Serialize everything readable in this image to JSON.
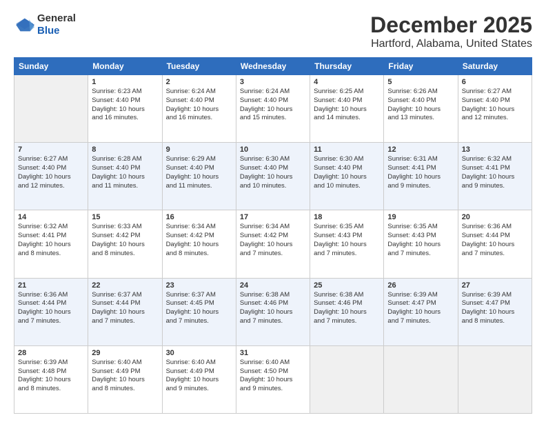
{
  "header": {
    "logo_general": "General",
    "logo_blue": "Blue",
    "title": "December 2025",
    "subtitle": "Hartford, Alabama, United States"
  },
  "calendar": {
    "days_of_week": [
      "Sunday",
      "Monday",
      "Tuesday",
      "Wednesday",
      "Thursday",
      "Friday",
      "Saturday"
    ],
    "rows": [
      [
        {
          "num": "",
          "info": ""
        },
        {
          "num": "1",
          "info": "Sunrise: 6:23 AM\nSunset: 4:40 PM\nDaylight: 10 hours\nand 16 minutes."
        },
        {
          "num": "2",
          "info": "Sunrise: 6:24 AM\nSunset: 4:40 PM\nDaylight: 10 hours\nand 16 minutes."
        },
        {
          "num": "3",
          "info": "Sunrise: 6:24 AM\nSunset: 4:40 PM\nDaylight: 10 hours\nand 15 minutes."
        },
        {
          "num": "4",
          "info": "Sunrise: 6:25 AM\nSunset: 4:40 PM\nDaylight: 10 hours\nand 14 minutes."
        },
        {
          "num": "5",
          "info": "Sunrise: 6:26 AM\nSunset: 4:40 PM\nDaylight: 10 hours\nand 13 minutes."
        },
        {
          "num": "6",
          "info": "Sunrise: 6:27 AM\nSunset: 4:40 PM\nDaylight: 10 hours\nand 12 minutes."
        }
      ],
      [
        {
          "num": "7",
          "info": "Sunrise: 6:27 AM\nSunset: 4:40 PM\nDaylight: 10 hours\nand 12 minutes."
        },
        {
          "num": "8",
          "info": "Sunrise: 6:28 AM\nSunset: 4:40 PM\nDaylight: 10 hours\nand 11 minutes."
        },
        {
          "num": "9",
          "info": "Sunrise: 6:29 AM\nSunset: 4:40 PM\nDaylight: 10 hours\nand 11 minutes."
        },
        {
          "num": "10",
          "info": "Sunrise: 6:30 AM\nSunset: 4:40 PM\nDaylight: 10 hours\nand 10 minutes."
        },
        {
          "num": "11",
          "info": "Sunrise: 6:30 AM\nSunset: 4:40 PM\nDaylight: 10 hours\nand 10 minutes."
        },
        {
          "num": "12",
          "info": "Sunrise: 6:31 AM\nSunset: 4:41 PM\nDaylight: 10 hours\nand 9 minutes."
        },
        {
          "num": "13",
          "info": "Sunrise: 6:32 AM\nSunset: 4:41 PM\nDaylight: 10 hours\nand 9 minutes."
        }
      ],
      [
        {
          "num": "14",
          "info": "Sunrise: 6:32 AM\nSunset: 4:41 PM\nDaylight: 10 hours\nand 8 minutes."
        },
        {
          "num": "15",
          "info": "Sunrise: 6:33 AM\nSunset: 4:42 PM\nDaylight: 10 hours\nand 8 minutes."
        },
        {
          "num": "16",
          "info": "Sunrise: 6:34 AM\nSunset: 4:42 PM\nDaylight: 10 hours\nand 8 minutes."
        },
        {
          "num": "17",
          "info": "Sunrise: 6:34 AM\nSunset: 4:42 PM\nDaylight: 10 hours\nand 7 minutes."
        },
        {
          "num": "18",
          "info": "Sunrise: 6:35 AM\nSunset: 4:43 PM\nDaylight: 10 hours\nand 7 minutes."
        },
        {
          "num": "19",
          "info": "Sunrise: 6:35 AM\nSunset: 4:43 PM\nDaylight: 10 hours\nand 7 minutes."
        },
        {
          "num": "20",
          "info": "Sunrise: 6:36 AM\nSunset: 4:44 PM\nDaylight: 10 hours\nand 7 minutes."
        }
      ],
      [
        {
          "num": "21",
          "info": "Sunrise: 6:36 AM\nSunset: 4:44 PM\nDaylight: 10 hours\nand 7 minutes."
        },
        {
          "num": "22",
          "info": "Sunrise: 6:37 AM\nSunset: 4:44 PM\nDaylight: 10 hours\nand 7 minutes."
        },
        {
          "num": "23",
          "info": "Sunrise: 6:37 AM\nSunset: 4:45 PM\nDaylight: 10 hours\nand 7 minutes."
        },
        {
          "num": "24",
          "info": "Sunrise: 6:38 AM\nSunset: 4:46 PM\nDaylight: 10 hours\nand 7 minutes."
        },
        {
          "num": "25",
          "info": "Sunrise: 6:38 AM\nSunset: 4:46 PM\nDaylight: 10 hours\nand 7 minutes."
        },
        {
          "num": "26",
          "info": "Sunrise: 6:39 AM\nSunset: 4:47 PM\nDaylight: 10 hours\nand 7 minutes."
        },
        {
          "num": "27",
          "info": "Sunrise: 6:39 AM\nSunset: 4:47 PM\nDaylight: 10 hours\nand 8 minutes."
        }
      ],
      [
        {
          "num": "28",
          "info": "Sunrise: 6:39 AM\nSunset: 4:48 PM\nDaylight: 10 hours\nand 8 minutes."
        },
        {
          "num": "29",
          "info": "Sunrise: 6:40 AM\nSunset: 4:49 PM\nDaylight: 10 hours\nand 8 minutes."
        },
        {
          "num": "30",
          "info": "Sunrise: 6:40 AM\nSunset: 4:49 PM\nDaylight: 10 hours\nand 9 minutes."
        },
        {
          "num": "31",
          "info": "Sunrise: 6:40 AM\nSunset: 4:50 PM\nDaylight: 10 hours\nand 9 minutes."
        },
        {
          "num": "",
          "info": ""
        },
        {
          "num": "",
          "info": ""
        },
        {
          "num": "",
          "info": ""
        }
      ]
    ]
  }
}
